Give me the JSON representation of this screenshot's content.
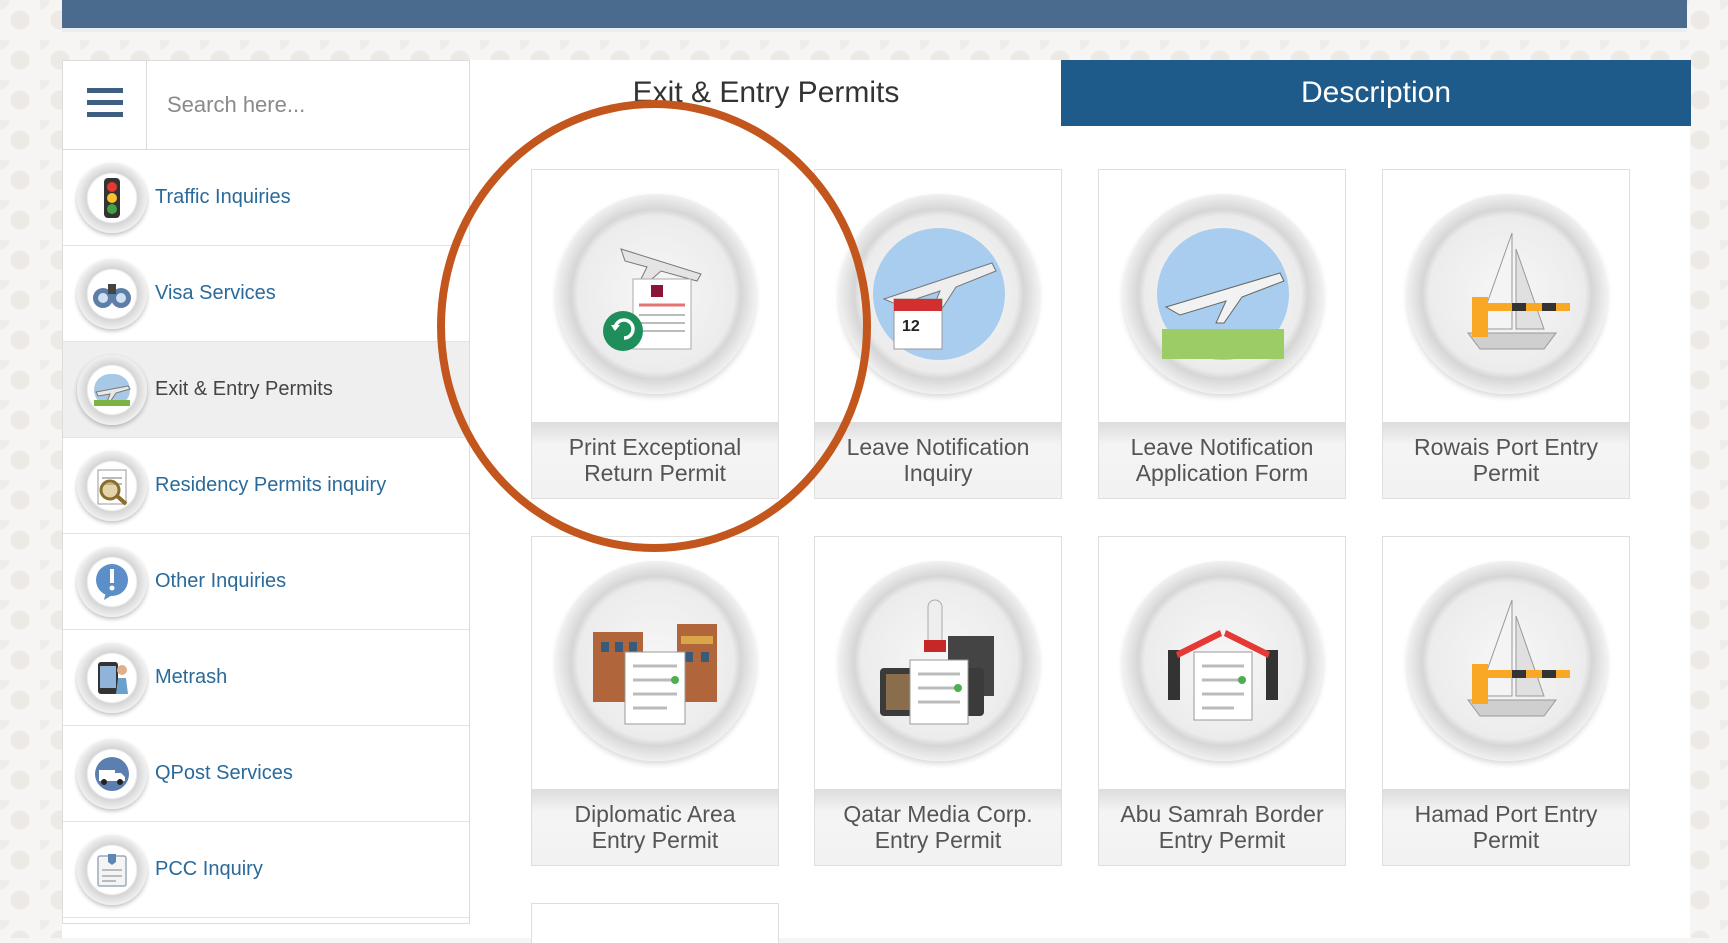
{
  "search": {
    "placeholder": "Search here..."
  },
  "sidebar": {
    "items": [
      {
        "label": "Traffic Inquiries",
        "icon": "traffic-light-icon"
      },
      {
        "label": "Visa Services",
        "icon": "binoculars-icon"
      },
      {
        "label": "Exit & Entry Permits",
        "icon": "airplane-icon",
        "active": true
      },
      {
        "label": "Residency Permits inquiry",
        "icon": "magnifier-document-icon"
      },
      {
        "label": "Other Inquiries",
        "icon": "exclamation-icon"
      },
      {
        "label": "Metrash",
        "icon": "phone-person-icon"
      },
      {
        "label": "QPost Services",
        "icon": "delivery-truck-icon"
      },
      {
        "label": "PCC Inquiry",
        "icon": "certificate-icon"
      }
    ]
  },
  "tabs": {
    "left": "Exit & Entry Permits",
    "right": "Description"
  },
  "cards": [
    {
      "line1": "Print Exceptional",
      "line2": "Return Permit",
      "icon": "plane-document-return-icon"
    },
    {
      "line1": "Leave Notification",
      "line2": "Inquiry",
      "icon": "plane-calendar-icon"
    },
    {
      "line1": "Leave Notification",
      "line2": "Application Form",
      "icon": "plane-sky-icon"
    },
    {
      "line1": "Rowais Port Entry",
      "line2": "Permit",
      "icon": "sailboat-barrier-icon"
    },
    {
      "line1": "Diplomatic Area",
      "line2": "Entry Permit",
      "icon": "embassy-building-icon"
    },
    {
      "line1": "Qatar Media Corp.",
      "line2": "Entry Permit",
      "icon": "media-tv-icon"
    },
    {
      "line1": "Abu Samrah Border",
      "line2": "Entry Permit",
      "icon": "border-barrier-icon"
    },
    {
      "line1": "Hamad Port Entry",
      "line2": "Permit",
      "icon": "sailboat-barrier-icon"
    }
  ],
  "colors": {
    "accent": "#1f5b8a",
    "link": "#2a6a9a",
    "highlight": "#c2561d",
    "topbar": "#4a6b8e"
  }
}
